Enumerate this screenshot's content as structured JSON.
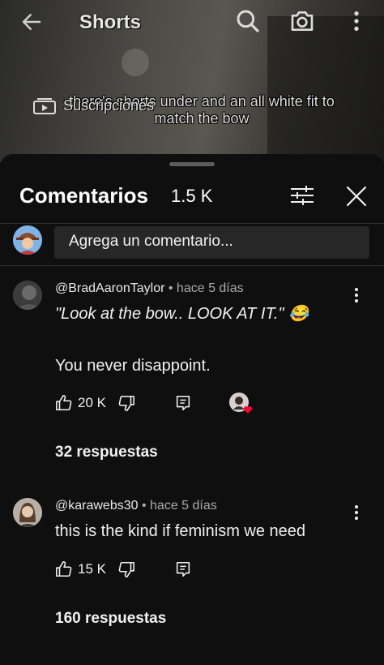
{
  "topbar": {
    "title": "Shorts",
    "back_icon": "arrow-left-icon",
    "search_icon": "search-icon",
    "camera_icon": "camera-icon",
    "more_icon": "more-vert-icon"
  },
  "video": {
    "caption": "there's shorts under and an all white fit to match the bow",
    "subscriptions_label": "Suscripciones"
  },
  "comments_panel": {
    "title": "Comentarios",
    "count": "1.5 K",
    "compose_placeholder": "Agrega un comentario...",
    "comments": [
      {
        "author": "@BradAaronTaylor",
        "time": "• hace 5 días",
        "text_line1": "\"Look at the bow.. LOOK AT IT.\" 😂",
        "text_line2": "You never disappoint.",
        "likes": "20 K",
        "replies": "32 respuestas",
        "creator_heart": true
      },
      {
        "author": "@karawebs30",
        "time": "• hace 5 días",
        "text_line1": "this is the kind if feminism we need",
        "likes": "15 K",
        "replies": "160 respuestas"
      }
    ]
  },
  "colors": {
    "background": "#0f0f0f",
    "input_bg": "#272727",
    "divider": "#303030",
    "meta_text": "#aaaaaa",
    "heart": "#ff0033"
  }
}
